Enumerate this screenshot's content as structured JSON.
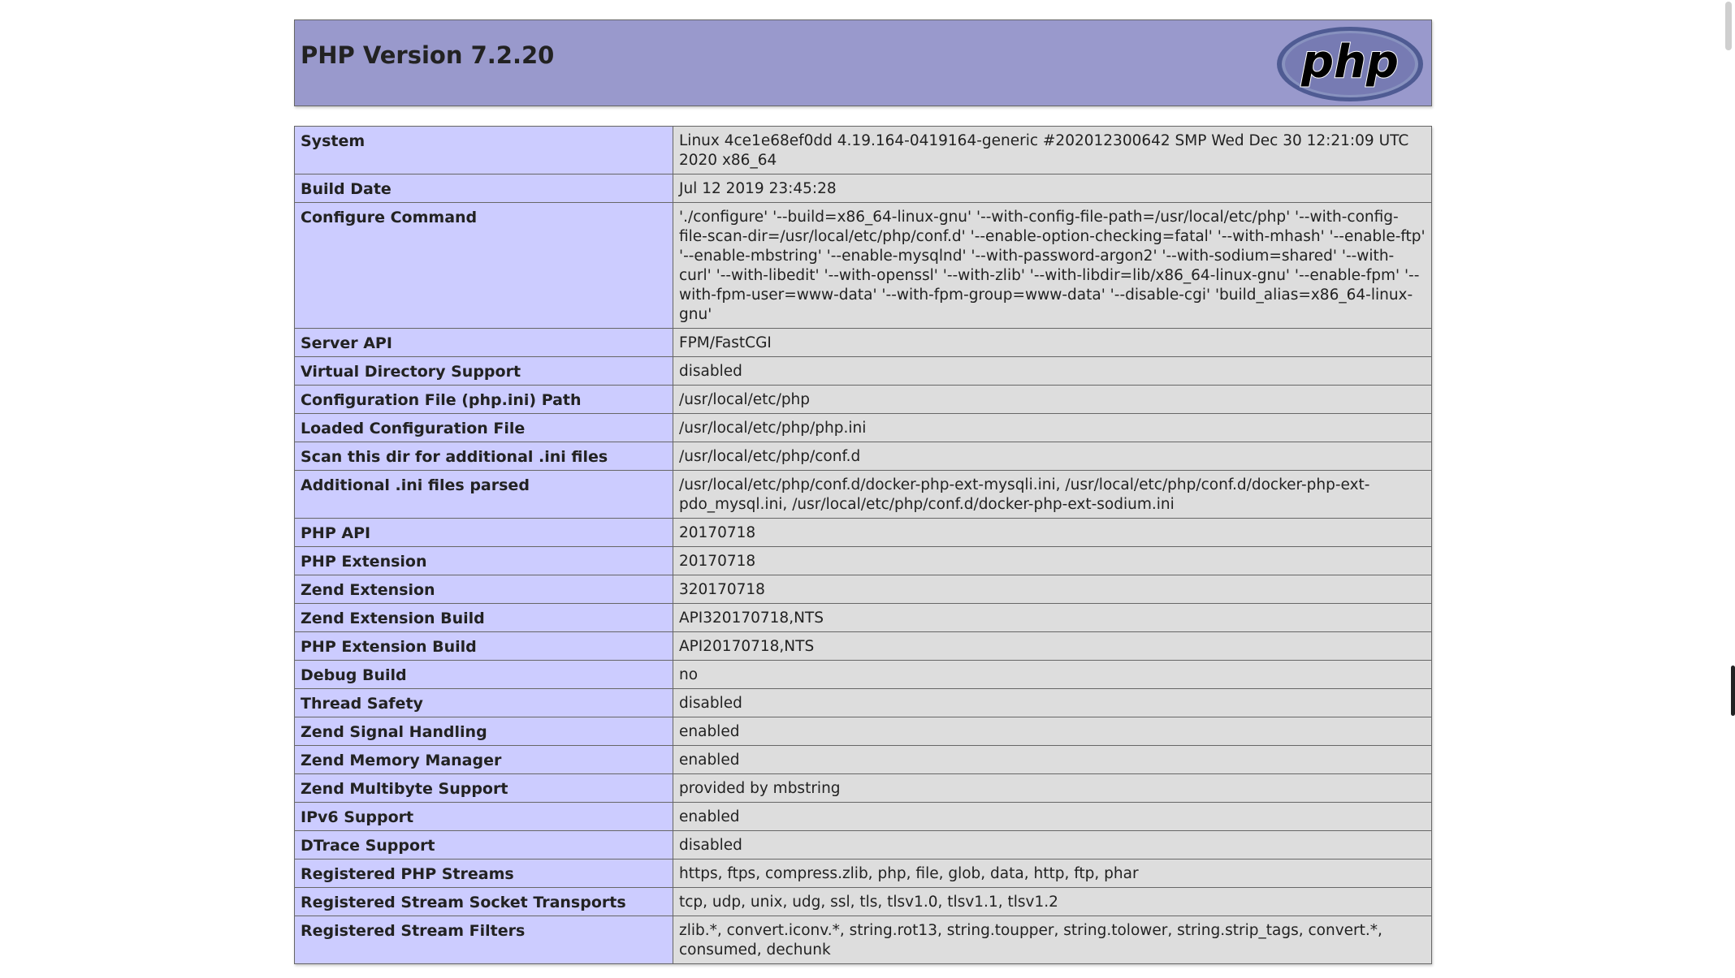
{
  "header": {
    "title": "PHP Version 7.2.20",
    "logo_text": "php"
  },
  "rows": [
    {
      "key": "System",
      "value": "Linux 4ce1e68ef0dd 4.19.164-0419164-generic #202012300642 SMP Wed Dec 30 12:21:09 UTC 2020 x86_64"
    },
    {
      "key": "Build Date",
      "value": "Jul 12 2019 23:45:28"
    },
    {
      "key": "Configure Command",
      "value": "'./configure' '--build=x86_64-linux-gnu' '--with-config-file-path=/usr/local/etc/php' '--with-config-file-scan-dir=/usr/local/etc/php/conf.d' '--enable-option-checking=fatal' '--with-mhash' '--enable-ftp' '--enable-mbstring' '--enable-mysqlnd' '--with-password-argon2' '--with-sodium=shared' '--with-curl' '--with-libedit' '--with-openssl' '--with-zlib' '--with-libdir=lib/x86_64-linux-gnu' '--enable-fpm' '--with-fpm-user=www-data' '--with-fpm-group=www-data' '--disable-cgi' 'build_alias=x86_64-linux-gnu'"
    },
    {
      "key": "Server API",
      "value": "FPM/FastCGI"
    },
    {
      "key": "Virtual Directory Support",
      "value": "disabled"
    },
    {
      "key": "Configuration File (php.ini) Path",
      "value": "/usr/local/etc/php"
    },
    {
      "key": "Loaded Configuration File",
      "value": "/usr/local/etc/php/php.ini"
    },
    {
      "key": "Scan this dir for additional .ini files",
      "value": "/usr/local/etc/php/conf.d"
    },
    {
      "key": "Additional .ini files parsed",
      "value": "/usr/local/etc/php/conf.d/docker-php-ext-mysqli.ini, /usr/local/etc/php/conf.d/docker-php-ext-pdo_mysql.ini, /usr/local/etc/php/conf.d/docker-php-ext-sodium.ini"
    },
    {
      "key": "PHP API",
      "value": "20170718"
    },
    {
      "key": "PHP Extension",
      "value": "20170718"
    },
    {
      "key": "Zend Extension",
      "value": "320170718"
    },
    {
      "key": "Zend Extension Build",
      "value": "API320170718,NTS"
    },
    {
      "key": "PHP Extension Build",
      "value": "API20170718,NTS"
    },
    {
      "key": "Debug Build",
      "value": "no"
    },
    {
      "key": "Thread Safety",
      "value": "disabled"
    },
    {
      "key": "Zend Signal Handling",
      "value": "enabled"
    },
    {
      "key": "Zend Memory Manager",
      "value": "enabled"
    },
    {
      "key": "Zend Multibyte Support",
      "value": "provided by mbstring"
    },
    {
      "key": "IPv6 Support",
      "value": "enabled"
    },
    {
      "key": "DTrace Support",
      "value": "disabled"
    },
    {
      "key": "Registered PHP Streams",
      "value": "https, ftps, compress.zlib, php, file, glob, data, http, ftp, phar"
    },
    {
      "key": "Registered Stream Socket Transports",
      "value": "tcp, udp, unix, udg, ssl, tls, tlsv1.0, tlsv1.1, tlsv1.2"
    },
    {
      "key": "Registered Stream Filters",
      "value": "zlib.*, convert.iconv.*, string.rot13, string.toupper, string.tolower, string.strip_tags, convert.*, consumed, dechunk"
    }
  ]
}
